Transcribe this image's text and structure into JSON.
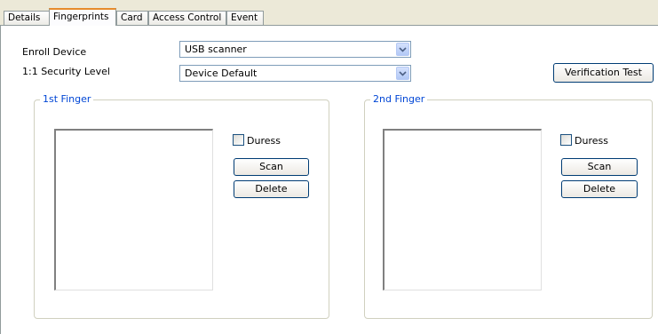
{
  "tabs": [
    {
      "label": "Details"
    },
    {
      "label": "Fingerprints"
    },
    {
      "label": "Card"
    },
    {
      "label": "Access Control"
    },
    {
      "label": "Event"
    }
  ],
  "form": {
    "enroll_device_label": "Enroll Device",
    "enroll_device_value": "USB scanner",
    "security_level_label": "1:1 Security Level",
    "security_level_value": "Device Default",
    "verification_test_label": "Verification Test"
  },
  "finger1": {
    "title": "1st Finger",
    "duress_label": "Duress",
    "scan_label": "Scan",
    "delete_label": "Delete"
  },
  "finger2": {
    "title": "2nd Finger",
    "duress_label": "Duress",
    "scan_label": "Scan",
    "delete_label": "Delete"
  },
  "colors": {
    "active_tab_accent": "#e68b2c",
    "group_title": "#0046d5",
    "combo_border": "#7f9db9"
  }
}
